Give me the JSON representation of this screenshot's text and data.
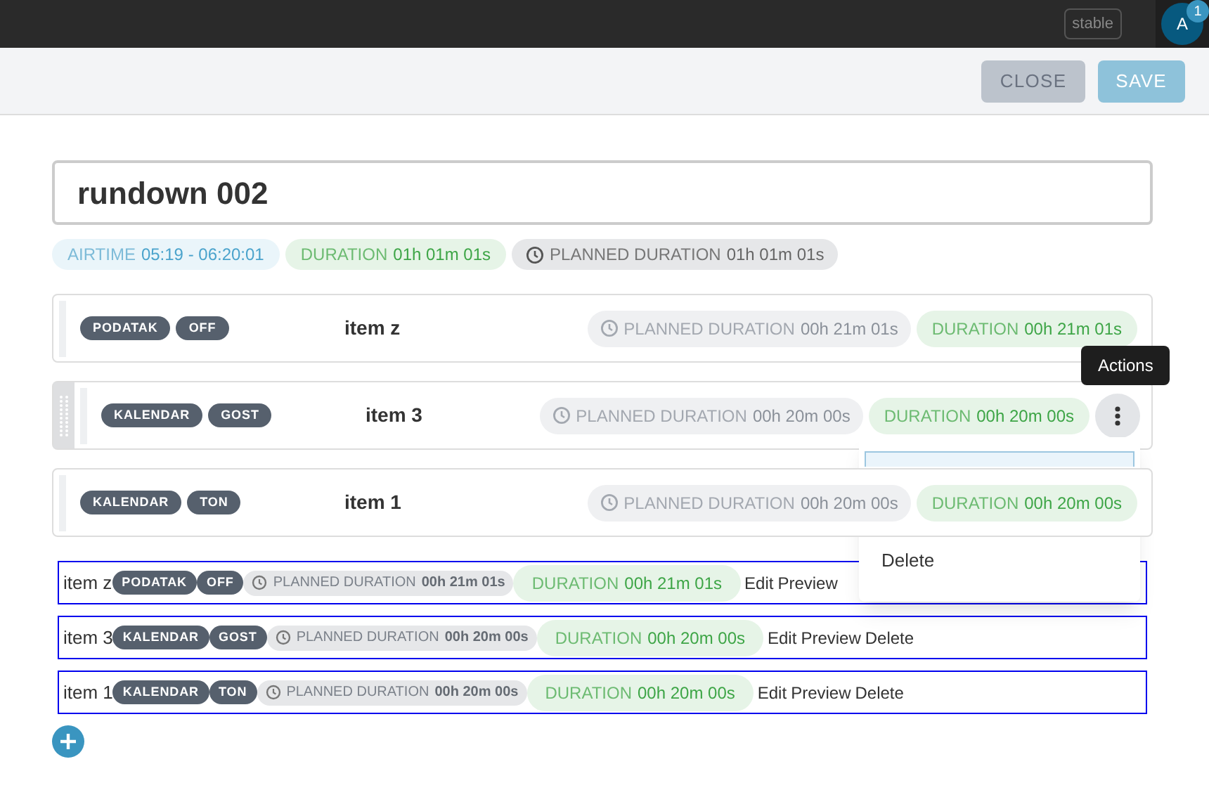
{
  "top_bar": {
    "env_badge": "stable",
    "avatar": {
      "initial": "A",
      "badge": "1"
    }
  },
  "toolbar": {
    "buttons": [
      {
        "label": "CLOSE",
        "kind": "secondary"
      },
      {
        "label": "SAVE",
        "kind": "primary"
      }
    ]
  },
  "title": "rundown 002",
  "summary": {
    "airtime_label": "AIRTIME",
    "airtime": "05:19 - 06:20:01",
    "duration_label": "DURATION",
    "duration": "01h 01m 01s",
    "planned_label": "PLANNED DURATION",
    "planned": "01h 01m 01s"
  },
  "items": [
    {
      "tags": [
        "PODATAK",
        "OFF"
      ],
      "name": "item z",
      "planned_label": "PLANNED DURATION",
      "planned": "00h 21m 01s",
      "duration_label": "DURATION",
      "duration": "00h 21m 01s",
      "hovered": false
    },
    {
      "tags": [
        "KALENDAR",
        "GOST"
      ],
      "name": "item 3",
      "planned_label": "PLANNED DURATION",
      "planned": "00h 20m 00s",
      "duration_label": "DURATION",
      "duration": "00h 20m 00s",
      "hovered": true
    },
    {
      "tags": [
        "KALENDAR",
        "TON"
      ],
      "name": "item 1",
      "planned_label": "PLANNED DURATION",
      "planned": "00h 20m 00s",
      "duration_label": "DURATION",
      "duration": "00h 20m 00s",
      "hovered": false
    }
  ],
  "tooltip": "Actions",
  "menu": {
    "items": [
      {
        "label": "Delete"
      }
    ]
  },
  "debug_rows": [
    {
      "name": "item z",
      "tags": [
        "PODATAK",
        "OFF"
      ],
      "planned_label": "PLANNED DURATION",
      "planned": "00h 21m 01s",
      "duration_label": "DURATION",
      "duration": "00h 21m 01s",
      "actions": [
        "Edit",
        "Preview"
      ]
    },
    {
      "name": "item 3",
      "tags": [
        "KALENDAR",
        "GOST"
      ],
      "planned_label": "PLANNED DURATION",
      "planned": "00h 20m 00s",
      "duration_label": "DURATION",
      "duration": "00h 20m 00s",
      "actions": [
        "Edit",
        "Preview",
        "Delete"
      ]
    },
    {
      "name": "item 1",
      "tags": [
        "KALENDAR",
        "TON"
      ],
      "planned_label": "PLANNED DURATION",
      "planned": "00h 20m 00s",
      "duration_label": "DURATION",
      "duration": "00h 20m 00s",
      "actions": [
        "Edit",
        "Preview",
        "Delete"
      ]
    }
  ]
}
